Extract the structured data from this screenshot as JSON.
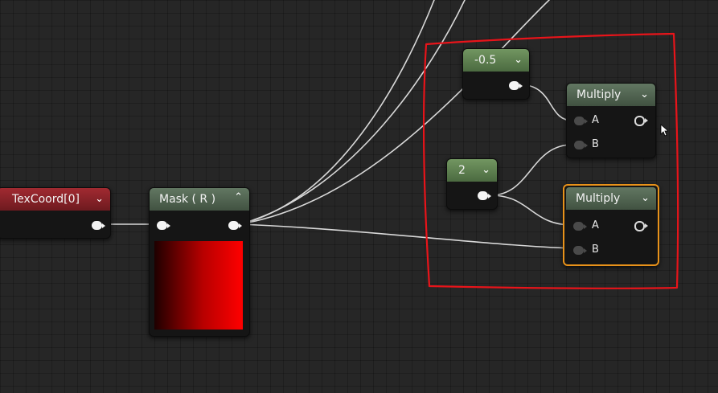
{
  "colors": {
    "canvas": "#262626",
    "header_red": "#a12a31",
    "header_green": "#729661",
    "header_gray": "#627762",
    "wire": "#d8d8d8",
    "selection": "#e8921a",
    "annotation": "#e8141a"
  },
  "nodes": {
    "texcoord": {
      "title": "TexCoord[0]",
      "icon": "chevron-down-icon"
    },
    "mask": {
      "title": "Mask ( R )",
      "icon": "chevron-up-icon",
      "preview": "red-gradient-preview"
    },
    "const_neg": {
      "title": "-0.5",
      "icon": "chevron-down-icon"
    },
    "const_two": {
      "title": "2",
      "icon": "chevron-down-icon"
    },
    "multiply_top": {
      "title": "Multiply",
      "pin_a": "A",
      "pin_b": "B",
      "icon": "chevron-down-icon"
    },
    "multiply_bottom": {
      "title": "Multiply",
      "pin_a": "A",
      "pin_b": "B",
      "icon": "chevron-down-icon",
      "selected": true
    }
  },
  "annotation": {
    "shape": "hand-drawn-rectangle",
    "color": "red"
  },
  "cursor": "mouse-pointer-icon"
}
